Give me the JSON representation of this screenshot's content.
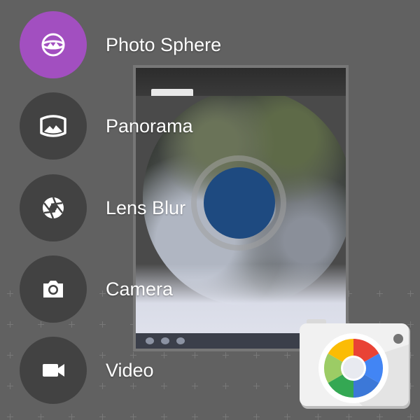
{
  "modes": [
    {
      "label": "Photo Sphere",
      "icon": "photo-sphere-icon",
      "active": true
    },
    {
      "label": "Panorama",
      "icon": "panorama-icon",
      "active": false
    },
    {
      "label": "Lens Blur",
      "icon": "aperture-icon",
      "active": false
    },
    {
      "label": "Camera",
      "icon": "camera-icon",
      "active": false
    },
    {
      "label": "Video",
      "icon": "videocam-icon",
      "active": false
    }
  ],
  "colors": {
    "background": "#616161",
    "active_mode": "#a24fc0",
    "inactive_mode": "#424242",
    "shutter": "#1e4a80"
  },
  "app_icon": "google-camera-app-icon"
}
